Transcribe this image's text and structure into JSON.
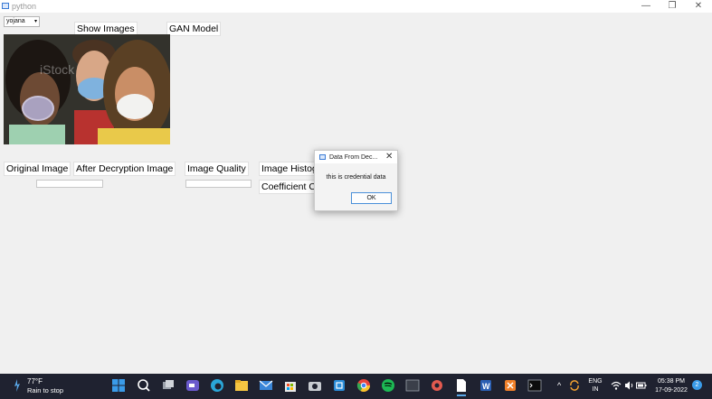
{
  "window": {
    "title": "python",
    "min_glyph": "—",
    "max_glyph": "❐",
    "close_glyph": "✕"
  },
  "controls": {
    "combo_value": "yojana",
    "combo_arrow": "▾",
    "show_images_label": "Show Images",
    "gan_model_label": "GAN Model",
    "original_image_label": "Original Image",
    "after_decryption_label": "After Decryption Image",
    "image_quality_label": "Image Quality",
    "image_histogram_label": "Image Histogram",
    "coefficient_label": "Coefficient Correlation"
  },
  "photo": {
    "watermark": "iStock"
  },
  "dialog": {
    "title": "Data From Dec...",
    "message": "this is credential data",
    "ok_label": "OK",
    "close_glyph": "✕"
  },
  "taskbar": {
    "weather_temp": "77°F",
    "weather_condition": "Rain to stop",
    "tray_chevron": "^",
    "language_top": "ENG",
    "language_bottom": "IN",
    "time": "05:38 PM",
    "date": "17-09-2022",
    "notification_count": "2",
    "apps": [
      "start",
      "search",
      "task-view",
      "meet",
      "edge",
      "file-explorer",
      "mail",
      "store",
      "camera",
      "snipping",
      "chrome",
      "spotify",
      "terminal",
      "settings",
      "notepad",
      "word",
      "xampp",
      "cmd"
    ],
    "colors": {
      "start": "#3a9be8",
      "edge": "#2aa6d8",
      "chrome": "#e8453c",
      "spotify": "#1db954",
      "word": "#2b5fb3",
      "xampp": "#f0802a",
      "folder": "#f4c542",
      "accent": "#4a90d9"
    }
  }
}
